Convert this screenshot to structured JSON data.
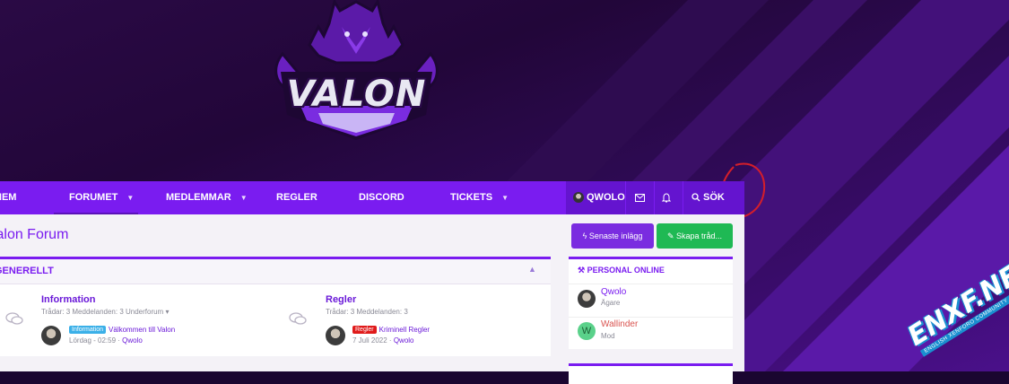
{
  "brand": {
    "logo_text": "VALON"
  },
  "nav": {
    "items": [
      {
        "label": "HEM",
        "caret": false
      },
      {
        "label": "FORUMET",
        "caret": true
      },
      {
        "label": "MEDLEMMAR",
        "caret": true
      },
      {
        "label": "REGLER",
        "caret": false
      },
      {
        "label": "DISCORD",
        "caret": false
      },
      {
        "label": "TICKETS",
        "caret": true
      }
    ],
    "user": "QWOLO",
    "search": "SÖK",
    "caret_glyph": "▼"
  },
  "page": {
    "title": "Valon Forum"
  },
  "category": {
    "title": "GENERELLT",
    "collapse_glyph": "▲",
    "nodes": [
      {
        "title": "Information",
        "meta": "Trådar: 3 Meddelanden: 3 Underforum ▾",
        "badge": "Information",
        "badge_color": "#3bb0e8",
        "latest_title": "Välkommen till Valon",
        "latest_date": "Lördag - 02:59 ·",
        "latest_user": "Qwolo"
      },
      {
        "title": "Regler",
        "meta": "Trådar: 3 Meddelanden: 3",
        "badge": "Regler",
        "badge_color": "#e01b1b",
        "latest_title": "Kriminell Regler",
        "latest_date": "7 Juli 2022 ·",
        "latest_user": "Qwolo"
      }
    ]
  },
  "actions": {
    "latest_posts": "Senaste inlägg",
    "create_thread": "Skapa tråd..."
  },
  "staff_online": {
    "title": "PERSONAL ONLINE",
    "members": [
      {
        "name": "Qwolo",
        "role": "Ägare",
        "name_color": "#7a1cf0"
      },
      {
        "name": "Wallinder",
        "role": "Mod",
        "name_color": "#d9534f",
        "initial": "W"
      }
    ]
  },
  "watermark": {
    "text": "ENXF.NET",
    "sub": "ENGLISH XENFORO COMMUNITY"
  },
  "colors": {
    "accent": "#7a1cf0",
    "green": "#1fb954"
  }
}
